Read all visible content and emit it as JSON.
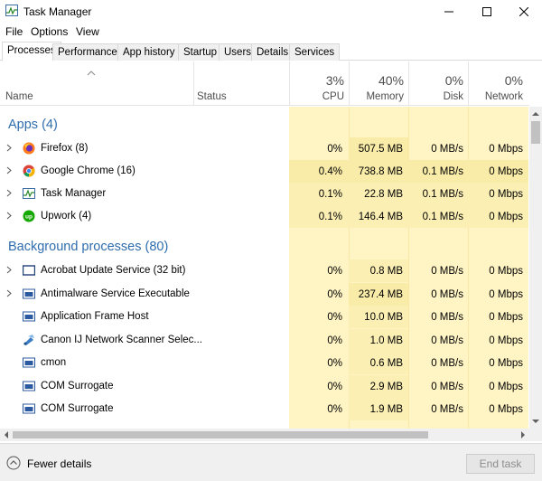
{
  "window": {
    "title": "Task Manager"
  },
  "menu": [
    "File",
    "Options",
    "View"
  ],
  "tabs": [
    "Processes",
    "Performance",
    "App history",
    "Startup",
    "Users",
    "Details",
    "Services"
  ],
  "columns": {
    "name": "Name",
    "status": "Status",
    "cpu": {
      "percent": "3%",
      "label": "CPU"
    },
    "memory": {
      "percent": "40%",
      "label": "Memory"
    },
    "disk": {
      "percent": "0%",
      "label": "Disk"
    },
    "network": {
      "percent": "0%",
      "label": "Network"
    }
  },
  "groups": {
    "apps": "Apps (4)",
    "background": "Background processes (80)"
  },
  "apps": [
    {
      "name": "Firefox (8)",
      "icon": "firefox-icon",
      "cpu": "0%",
      "memory": "507.5 MB",
      "disk": "0 MB/s",
      "network": "0 Mbps"
    },
    {
      "name": "Google Chrome (16)",
      "icon": "chrome-icon",
      "cpu": "0.4%",
      "memory": "738.8 MB",
      "disk": "0.1 MB/s",
      "network": "0 Mbps"
    },
    {
      "name": "Task Manager",
      "icon": "task-manager-icon",
      "cpu": "0.1%",
      "memory": "22.8 MB",
      "disk": "0.1 MB/s",
      "network": "0 Mbps"
    },
    {
      "name": "Upwork (4)",
      "icon": "upwork-icon",
      "cpu": "0.1%",
      "memory": "146.4 MB",
      "disk": "0.1 MB/s",
      "network": "0 Mbps"
    }
  ],
  "background": [
    {
      "name": "Acrobat Update Service (32 bit)",
      "icon": "service-window-icon",
      "cpu": "0%",
      "memory": "0.8 MB",
      "disk": "0 MB/s",
      "network": "0 Mbps"
    },
    {
      "name": "Antimalware Service Executable",
      "icon": "service-window-icon",
      "cpu": "0%",
      "memory": "237.4 MB",
      "disk": "0 MB/s",
      "network": "0 Mbps"
    },
    {
      "name": "Application Frame Host",
      "icon": "service-window-icon",
      "cpu": "0%",
      "memory": "10.0 MB",
      "disk": "0 MB/s",
      "network": "0 Mbps"
    },
    {
      "name": "Canon IJ Network Scanner Selec...",
      "icon": "scanner-icon",
      "cpu": "0%",
      "memory": "1.0 MB",
      "disk": "0 MB/s",
      "network": "0 Mbps"
    },
    {
      "name": "cmon",
      "icon": "service-window-icon",
      "cpu": "0%",
      "memory": "0.6 MB",
      "disk": "0 MB/s",
      "network": "0 Mbps"
    },
    {
      "name": "COM Surrogate",
      "icon": "service-window-icon",
      "cpu": "0%",
      "memory": "2.9 MB",
      "disk": "0 MB/s",
      "network": "0 Mbps"
    },
    {
      "name": "COM Surrogate",
      "icon": "service-window-icon",
      "cpu": "0%",
      "memory": "1.9 MB",
      "disk": "0 MB/s",
      "network": "0 Mbps"
    }
  ],
  "footer": {
    "fewer_details": "Fewer details",
    "end_task": "End task"
  },
  "colors": {
    "heat_light": "#fff4c4",
    "heat_medium": "#f9eca8",
    "group_title": "#2f6dad"
  }
}
